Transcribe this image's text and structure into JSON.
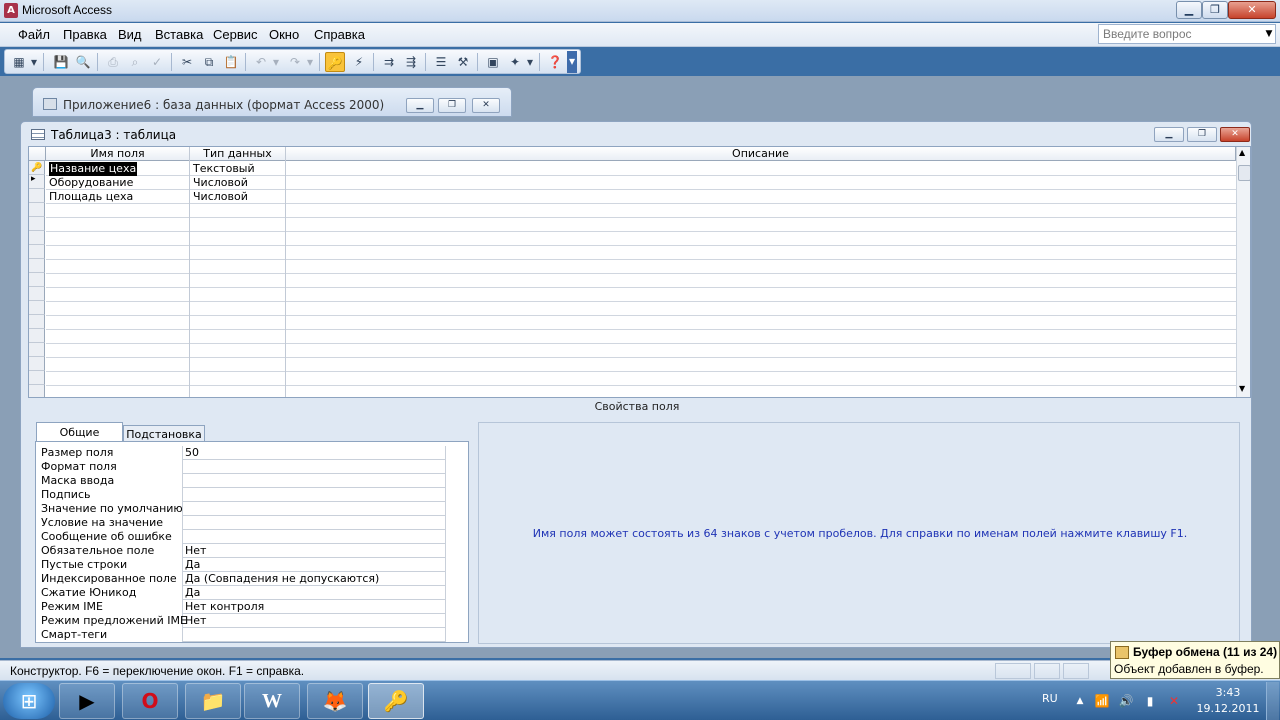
{
  "app": {
    "title": "Microsoft Access"
  },
  "menu": {
    "items": [
      "Файл",
      "Правка",
      "Вид",
      "Вставка",
      "Сервис",
      "Окно",
      "Справка"
    ],
    "help_placeholder": "Введите вопрос"
  },
  "db_window": {
    "title": "Приложение6 : база данных (формат Access 2000)"
  },
  "table_window": {
    "title": "Таблица3 : таблица",
    "columns": [
      "Имя поля",
      "Тип данных",
      "Описание"
    ],
    "rows": [
      {
        "name": "Название цеха",
        "type": "Текстовый",
        "desc": ""
      },
      {
        "name": "Оборудование",
        "type": "Числовой",
        "desc": ""
      },
      {
        "name": "Площадь цеха",
        "type": "Числовой",
        "desc": ""
      }
    ]
  },
  "properties": {
    "title": "Свойства поля",
    "tabs": [
      "Общие",
      "Подстановка"
    ],
    "rows": [
      {
        "label": "Размер поля",
        "value": "50"
      },
      {
        "label": "Формат поля",
        "value": ""
      },
      {
        "label": "Маска ввода",
        "value": ""
      },
      {
        "label": "Подпись",
        "value": ""
      },
      {
        "label": "Значение по умолчанию",
        "value": ""
      },
      {
        "label": "Условие на значение",
        "value": ""
      },
      {
        "label": "Сообщение об ошибке",
        "value": ""
      },
      {
        "label": "Обязательное поле",
        "value": "Нет"
      },
      {
        "label": "Пустые строки",
        "value": "Да"
      },
      {
        "label": "Индексированное поле",
        "value": "Да (Совпадения не допускаются)"
      },
      {
        "label": "Сжатие Юникод",
        "value": "Да"
      },
      {
        "label": "Режим IME",
        "value": "Нет контроля"
      },
      {
        "label": "Режим предложений IME",
        "value": "Нет"
      },
      {
        "label": "Смарт-теги",
        "value": ""
      }
    ],
    "hint": "Имя поля может состоять из 64 знаков с учетом пробелов.  Для справки по именам полей нажмите клавишу F1."
  },
  "status": {
    "text": "Конструктор.  F6 = переключение окон.  F1 = справка."
  },
  "clipboard": {
    "title": "Буфер обмена (11 из 24)",
    "message": "Объект добавлен в буфер."
  },
  "taskbar": {
    "lang": "RU",
    "time": "3:43",
    "date": "19.12.2011"
  },
  "colors": {
    "accent": "#3a6ea5",
    "hint_text": "#1f33b5",
    "key_toolbar_active": "#f9c33a"
  }
}
